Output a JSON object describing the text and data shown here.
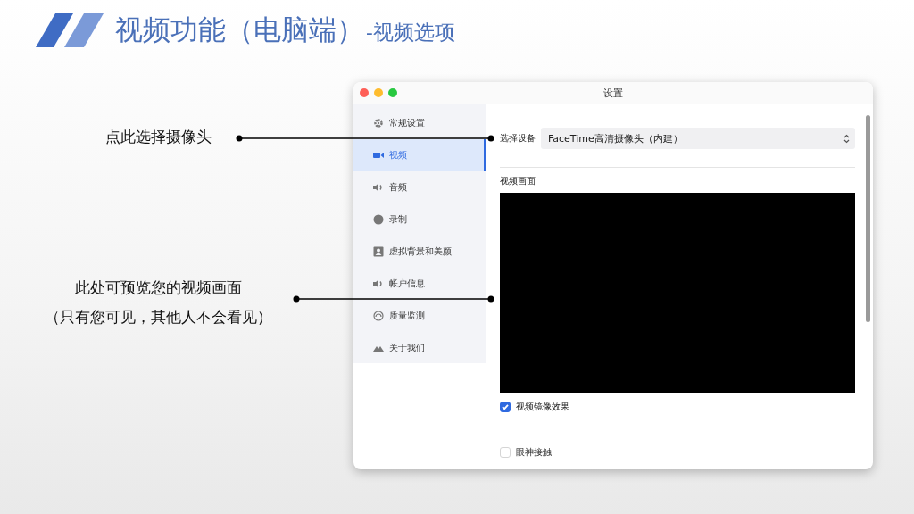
{
  "slide": {
    "title": "视频功能（电脑端）",
    "subtitle": "-视频选项"
  },
  "annotations": [
    {
      "lines": [
        "点此选择摄像头"
      ]
    },
    {
      "lines": [
        "此处可预览您的视频画面",
        "（只有您可见，其他人不会看见）"
      ]
    }
  ],
  "window": {
    "title": "设置",
    "sidebar": [
      {
        "label": "常规设置",
        "kind": "gear",
        "selected": false
      },
      {
        "label": "视频",
        "kind": "camera",
        "selected": true
      },
      {
        "label": "音频",
        "kind": "speaker",
        "selected": false
      },
      {
        "label": "录制",
        "kind": "record",
        "selected": false
      },
      {
        "label": "虚拟背景和美颜",
        "kind": "portrait",
        "selected": false
      },
      {
        "label": "帐户信息",
        "kind": "speaker",
        "selected": false
      },
      {
        "label": "质量监测",
        "kind": "gauge",
        "selected": false
      },
      {
        "label": "关于我们",
        "kind": "mountain",
        "selected": false
      }
    ],
    "device": {
      "label": "选择设备",
      "value": "FaceTime高清摄像头（内建）"
    },
    "preview_label": "视频画面",
    "options": [
      {
        "label": "视频镜像效果",
        "checked": true
      },
      {
        "label": "眼神接触",
        "checked": false
      }
    ]
  }
}
